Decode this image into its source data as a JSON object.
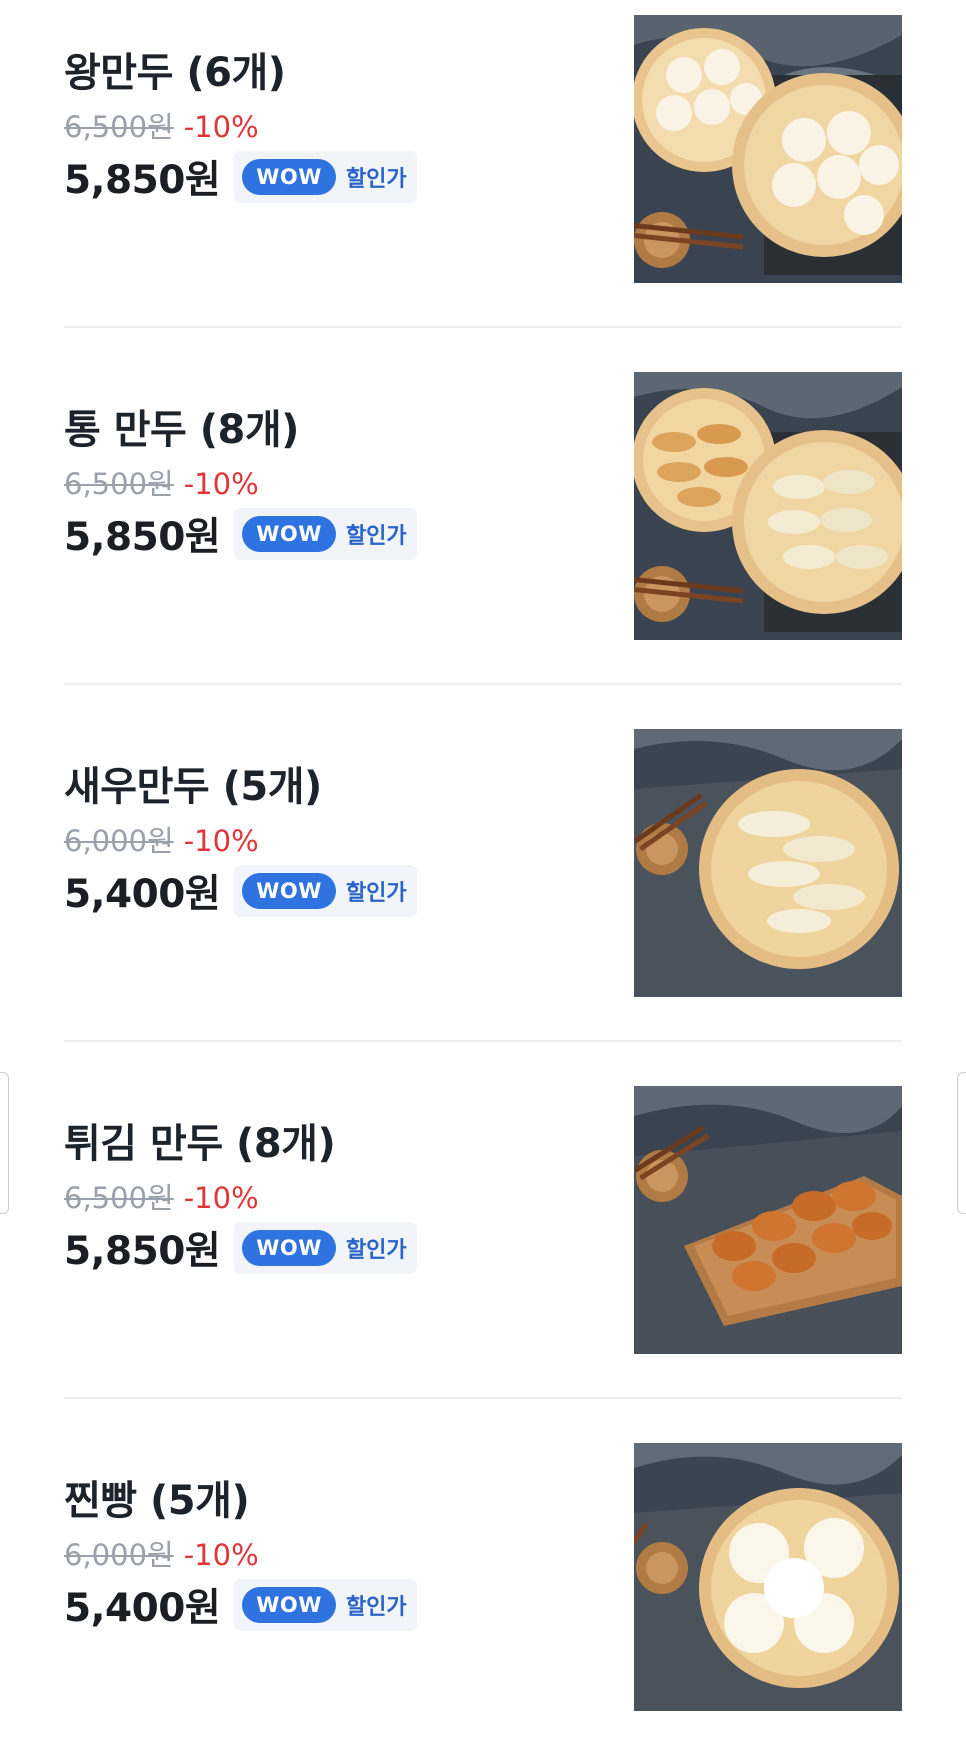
{
  "menu": {
    "items": [
      {
        "name": "왕만두 (6개)",
        "original_price": "6,500원",
        "discount": "-10%",
        "sale_price": "5,850원",
        "badge": "WOW",
        "badge_text": "할인가",
        "image": "steamed-meat-buns-in-bamboo-steamers"
      },
      {
        "name": "통 만두 (8개)",
        "original_price": "6,500원",
        "discount": "-10%",
        "sale_price": "5,850원",
        "badge": "WOW",
        "badge_text": "할인가",
        "image": "pan-fried-dumplings-in-bamboo-steamers"
      },
      {
        "name": "새우만두 (5개)",
        "original_price": "6,000원",
        "discount": "-10%",
        "sale_price": "5,400원",
        "badge": "WOW",
        "badge_text": "할인가",
        "image": "shrimp-dumplings-in-bamboo-steamer"
      },
      {
        "name": "튀김 만두 (8개)",
        "original_price": "6,500원",
        "discount": "-10%",
        "sale_price": "5,850원",
        "badge": "WOW",
        "badge_text": "할인가",
        "image": "fried-dumplings-on-wooden-board"
      },
      {
        "name": "찐빵 (5개)",
        "original_price": "6,000원",
        "discount": "-10%",
        "sale_price": "5,400원",
        "badge": "WOW",
        "badge_text": "할인가",
        "image": "steamed-buns-in-bamboo-steamer"
      }
    ]
  },
  "colors": {
    "discount": "#e0363a",
    "wow_badge": "#2f73e0",
    "wow_text": "#2a64c9",
    "strike_price": "#9aa1ab",
    "divider": "#eceef1"
  }
}
